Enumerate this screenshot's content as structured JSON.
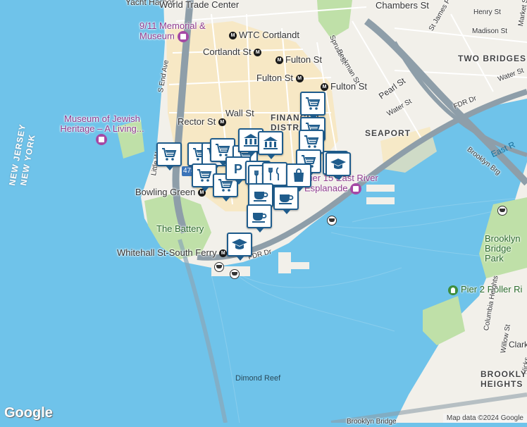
{
  "labels": {
    "yacht_harbor": "Yacht Harbor",
    "world_trade_center": "World Trade Center",
    "chambers_st": "Chambers St",
    "henry_st": "Henry St",
    "st_james_pl": "St James Pl",
    "market_st": "Market St",
    "madison_st": "Madison St",
    "memorial": "9/11 Memorial & Museum",
    "wtc_cortlandt": "WTC Cortlandt",
    "spruce_st": "Spruce St",
    "two_bridges": "TWO BRIDGES",
    "cortlandt_st": "Cortlandt St",
    "fulton_st_1": "Fulton St",
    "fulton_st_2": "Fulton St",
    "fulton_st_3": "Fulton St",
    "beekman_st": "Beekman St",
    "water_st_1": "Water St",
    "water_st_2": "Water St",
    "s_end_ave": "S End Ave",
    "pearl_st": "Pearl St",
    "fdr_dr_1": "FDR Dr",
    "fdr_dr_2": "FDR Dr",
    "museum_jewish": "Museum of Jewish Heritage – A Living...",
    "wall_st": "Wall St",
    "rector_st": "Rector St",
    "financial_district": "FINANCIAL DISTRICT",
    "seaport": "SEAPORT",
    "new_jersey": "NEW JERSEY",
    "new_york": "NEW YORK",
    "little_west": "Little W",
    "east_river": "East R",
    "brooklyn_brg": "Brooklyn Brg",
    "bowling_green": "Bowling Green",
    "pier15": "Pier 15 East River Esplanade",
    "the_battery": "The Battery",
    "whitehall": "Whitehall St-South Ferry",
    "brooklyn_bridge_park": "Brooklyn Bridge Park",
    "pier2": "Pier 2 Roller Ri",
    "columbia_heights": "Columbia Heights",
    "willow_st": "Willow St",
    "clark": "Clark",
    "hicks": "Hicks",
    "brooklyn_heights": "BROOKLYN HEIGHTS",
    "dimond_reef": "Dimond Reef",
    "brooklyn_bridge_bottom": "Brooklyn Bridge",
    "i478": "478"
  },
  "pins": [
    {
      "kind": "grocery",
      "icon": "shopping-cart-icon"
    },
    {
      "kind": "grocery",
      "icon": "shopping-cart-icon"
    },
    {
      "kind": "grocery",
      "icon": "shopping-cart-icon"
    },
    {
      "kind": "grocery",
      "icon": "shopping-cart-icon"
    },
    {
      "kind": "grocery",
      "icon": "shopping-cart-icon"
    },
    {
      "kind": "grocery",
      "icon": "shopping-cart-icon"
    },
    {
      "kind": "grocery",
      "icon": "shopping-cart-icon"
    },
    {
      "kind": "grocery",
      "icon": "shopping-cart-icon"
    },
    {
      "kind": "grocery",
      "icon": "shopping-cart-icon"
    },
    {
      "kind": "grocery",
      "icon": "shopping-cart-icon"
    },
    {
      "kind": "grocery",
      "icon": "shopping-cart-icon"
    },
    {
      "kind": "grocery",
      "icon": "shopping-cart-icon"
    },
    {
      "kind": "bank",
      "icon": "bank-icon"
    },
    {
      "kind": "bank",
      "icon": "bank-icon"
    },
    {
      "kind": "parking",
      "icon": "parking-icon"
    },
    {
      "kind": "parking",
      "icon": "parking-icon"
    },
    {
      "kind": "restaurant",
      "icon": "fork-knife-icon"
    },
    {
      "kind": "restaurant",
      "icon": "fork-knife-icon"
    },
    {
      "kind": "shopping",
      "icon": "shopping-bag-icon"
    },
    {
      "kind": "cafe",
      "icon": "coffee-cup-icon"
    },
    {
      "kind": "cafe",
      "icon": "coffee-cup-icon"
    },
    {
      "kind": "cafe",
      "icon": "coffee-cup-icon"
    },
    {
      "kind": "school",
      "icon": "graduation-cap-icon"
    },
    {
      "kind": "school",
      "icon": "graduation-cap-icon"
    }
  ],
  "footer": {
    "logo": "Google",
    "attribution": "Map data ©2024 Google"
  },
  "colors": {
    "water": "#6fc3ea",
    "land": "#f2f0ea",
    "district": "#f8e6b8",
    "park": "#bfe0a8",
    "highway": "#8e9ea9",
    "pin_border": "#1f5c8c"
  }
}
